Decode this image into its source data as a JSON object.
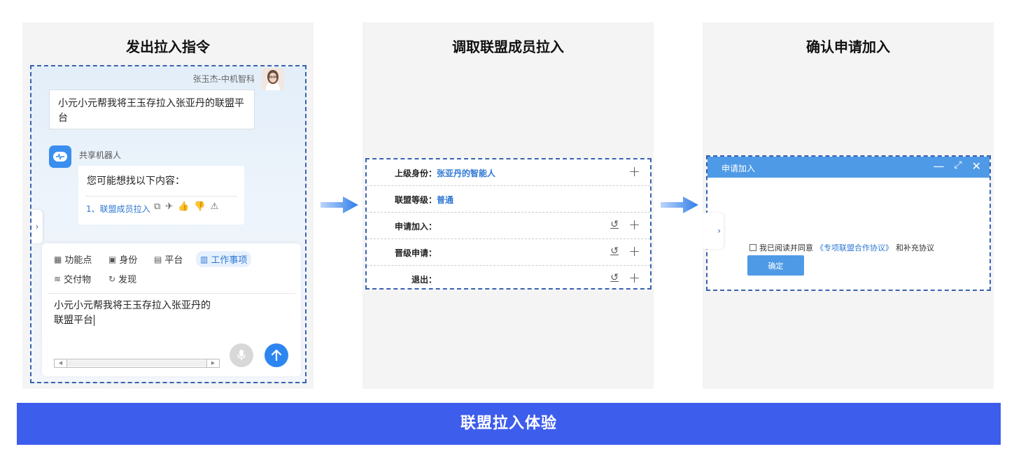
{
  "panels": {
    "p1": {
      "title": "发出拉入指令",
      "sender_name": "张玉杰-中机智科",
      "user_message": "小元小元帮我将王玉存拉入张亚丹的联盟平台",
      "bot_name": "共享机器人",
      "bot_intro": "您可能想找以下内容：",
      "bot_link": "1、联盟成员拉入",
      "toolbar": [
        {
          "label": "功能点",
          "icon": "grid-icon"
        },
        {
          "label": "身份",
          "icon": "id-card-icon"
        },
        {
          "label": "平台",
          "icon": "code-window-icon"
        },
        {
          "label": "工作事项",
          "icon": "task-icon",
          "active": true
        },
        {
          "label": "交付物",
          "icon": "layers-icon"
        },
        {
          "label": "发现",
          "icon": "refresh-icon"
        }
      ],
      "composer_text_line1": "小元小元帮我将王玉存拉入张亚丹的",
      "composer_text_line2": "联盟平台"
    },
    "p2": {
      "title": "调取联盟成员拉入",
      "rows": [
        {
          "label": "上级身份：",
          "value": "张亚丹的智能人"
        },
        {
          "label": "联盟等级：",
          "value": "普通"
        },
        {
          "label": "申请加入：",
          "value": ""
        },
        {
          "label": "晋级申请：",
          "value": ""
        },
        {
          "label": "退出：",
          "value": ""
        }
      ],
      "plus": "+",
      "undo": "↺"
    },
    "p3": {
      "title": "确认申请加入",
      "dialog_title": "申请加入",
      "agree_prefix": "我已阅读并同意",
      "agree_link": "《专项联盟合作协议》",
      "agree_suffix": "和补充协议",
      "confirm": "确定"
    }
  },
  "banner": "联盟拉入体验",
  "colors": {
    "accent": "#3d5ded",
    "link": "#2f78d4",
    "dashed": "#3a62b0"
  }
}
